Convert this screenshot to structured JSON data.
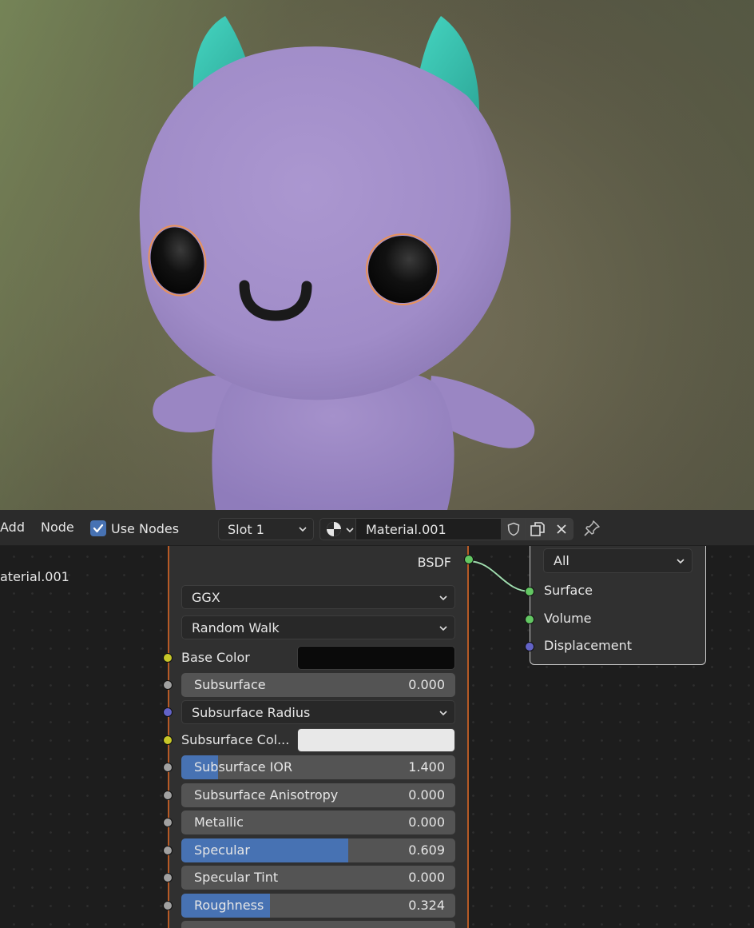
{
  "header": {
    "menu_add": "Add",
    "menu_node": "Node",
    "use_nodes_label": "Use Nodes",
    "use_nodes_checked": true,
    "slot_value": "Slot 1",
    "material_name": "Material.001"
  },
  "icons": {
    "material_type": "material-sphere-icon",
    "fake_user": "shield-icon",
    "duplicate": "duplicate-icon",
    "unlink": "close-icon",
    "pin": "pin-icon"
  },
  "editor": {
    "material_label": "aterial.001"
  },
  "bsdf": {
    "output_label": "BSDF",
    "distribution": "GGX",
    "subsurface_method": "Random Walk",
    "base_color_label": "Base Color",
    "base_color_value": "#0a0a0a",
    "subsurface": {
      "label": "Subsurface",
      "value": "0.000",
      "fraction": 0.0
    },
    "subsurface_radius_label": "Subsurface Radius",
    "subsurface_color_label": "Subsurface Col...",
    "subsurface_color_value": "#e8e8e8",
    "subsurface_ior": {
      "label": "Subsurface IOR",
      "value": "1.400",
      "fraction": 0.133
    },
    "subsurface_anisotropy": {
      "label": "Subsurface Anisotropy",
      "value": "0.000",
      "fraction": 0.0
    },
    "metallic": {
      "label": "Metallic",
      "value": "0.000",
      "fraction": 0.0
    },
    "specular": {
      "label": "Specular",
      "value": "0.609",
      "fraction": 0.609
    },
    "specular_tint": {
      "label": "Specular Tint",
      "value": "0.000",
      "fraction": 0.0
    },
    "roughness": {
      "label": "Roughness",
      "value": "0.324",
      "fraction": 0.324
    }
  },
  "output": {
    "target": "All",
    "surface_label": "Surface",
    "volume_label": "Volume",
    "displacement_label": "Displacement"
  },
  "colors": {
    "accent": "#4772b3",
    "node_border_active": "#b75a26",
    "socket_shader": "#63c763",
    "socket_color": "#c7c729",
    "socket_float": "#a1a1a1",
    "socket_vector": "#6363c7",
    "character_body": "#a48fca",
    "character_horns": "#3fc9b6"
  }
}
